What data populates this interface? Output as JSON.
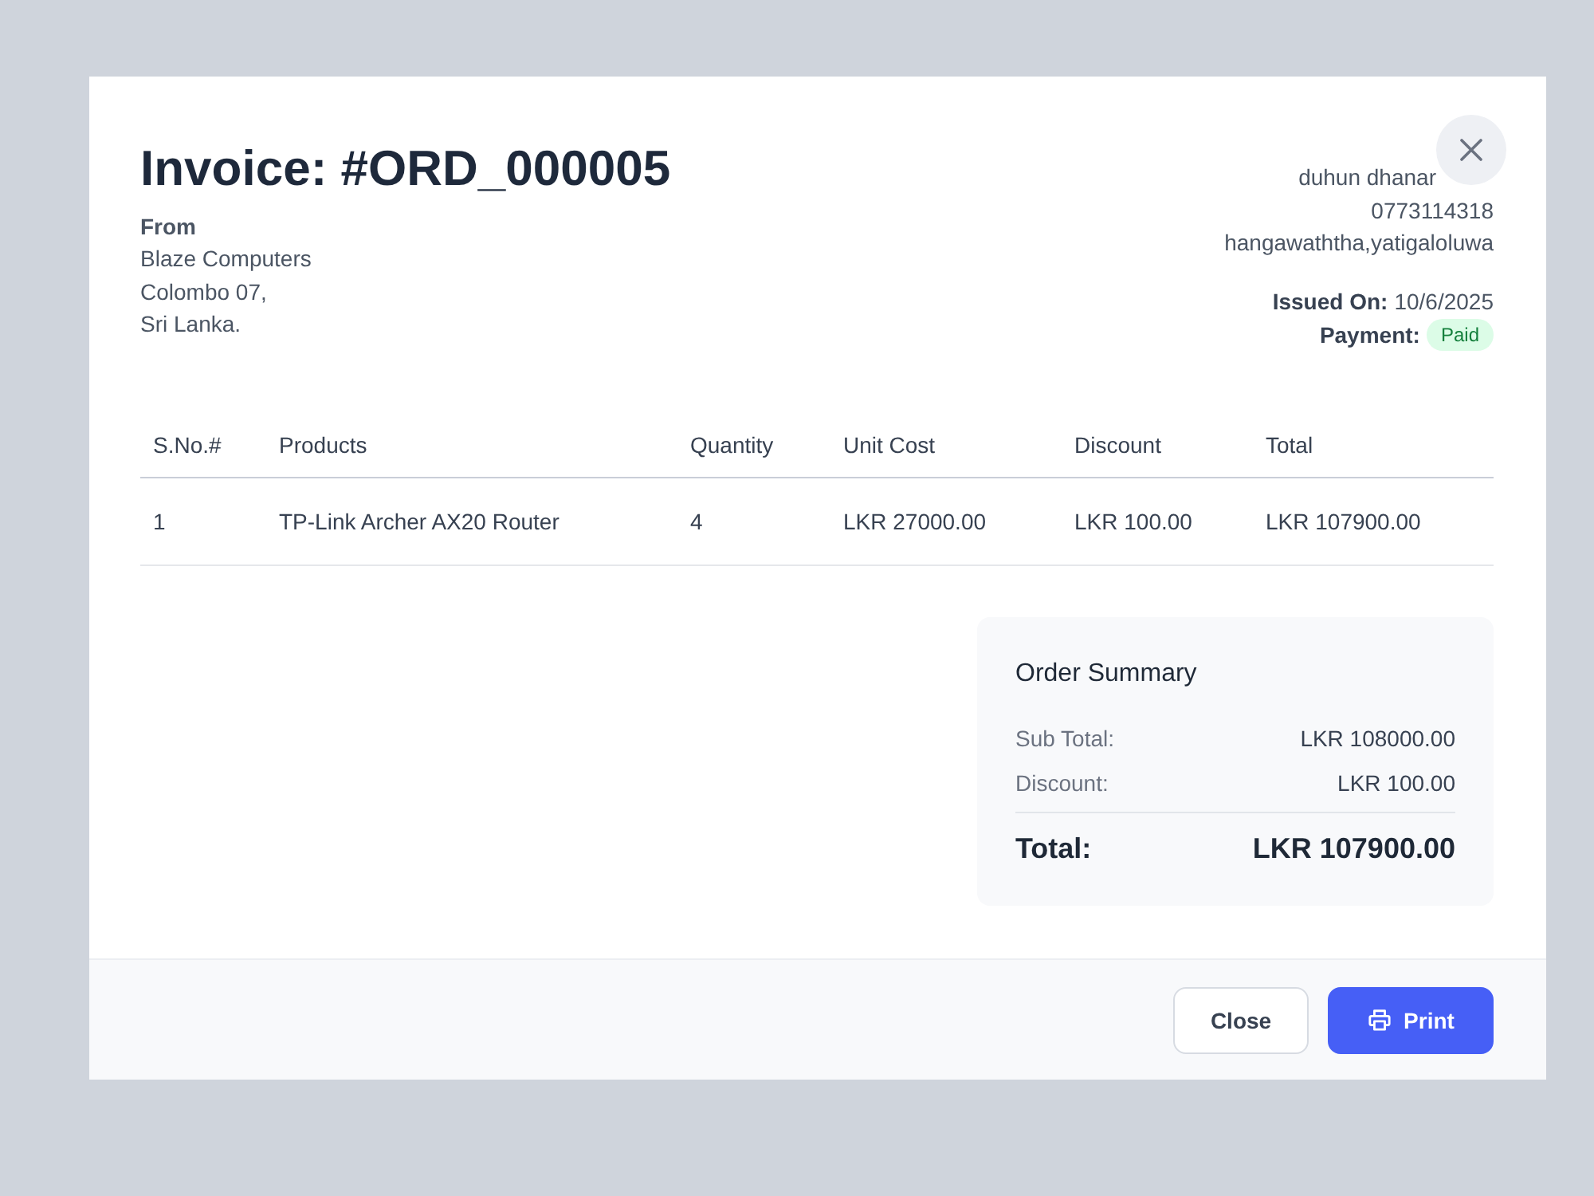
{
  "invoice": {
    "title": "Invoice: #ORD_000005",
    "from": {
      "label": "From",
      "lines": [
        "Blaze Computers",
        "Colombo 07,",
        "Sri Lanka."
      ]
    },
    "customer": {
      "lines": [
        "duhun dhanar",
        "0773114318",
        "hangawaththa,yatigaloluwa"
      ]
    },
    "issued": {
      "label": "Issued On:",
      "value": "10/6/2025"
    },
    "payment": {
      "label": "Payment:",
      "status": "Paid",
      "kind": "paid"
    }
  },
  "table": {
    "columns": [
      "S.No.#",
      "Products",
      "Quantity",
      "Unit Cost",
      "Discount",
      "Total"
    ],
    "rows": [
      {
        "cells": [
          "1",
          "TP-Link Archer AX20 Router",
          "4",
          "LKR 27000.00",
          "LKR 100.00",
          "LKR 107900.00"
        ]
      }
    ]
  },
  "summary": {
    "title": "Order Summary",
    "lines": [
      {
        "label": "Sub Total:",
        "value": "LKR 108000.00"
      },
      {
        "label": "Discount:",
        "value": "LKR 100.00"
      }
    ],
    "total": {
      "label": "Total:",
      "value": "LKR 107900.00"
    }
  },
  "footer": {
    "buttons": [
      {
        "label": "Close",
        "kind": "plain"
      },
      {
        "label": "Print",
        "kind": "print"
      }
    ]
  }
}
